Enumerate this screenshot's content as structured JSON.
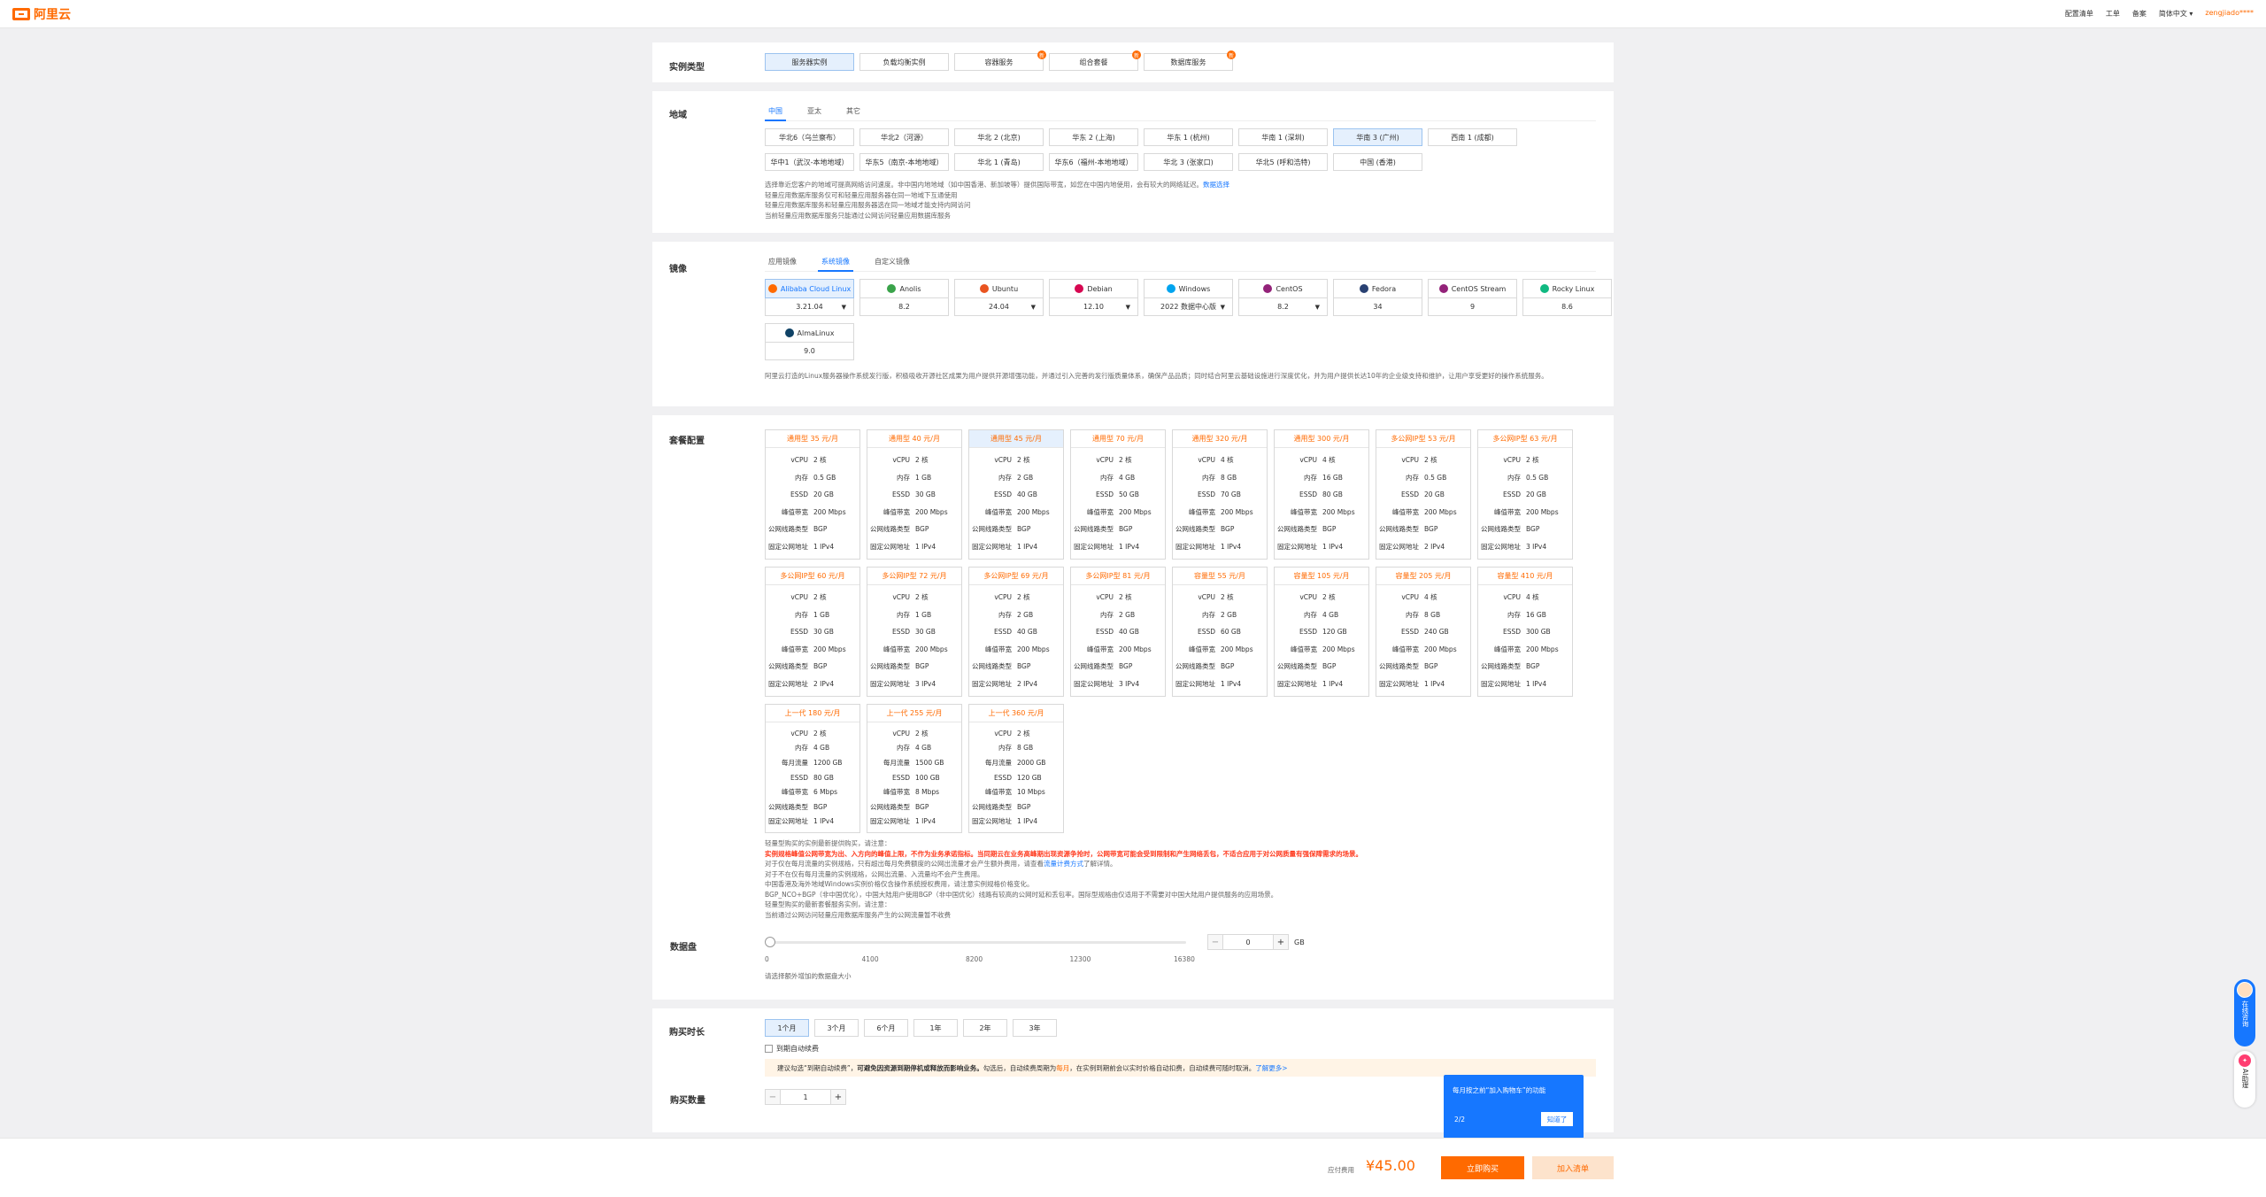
{
  "topbar": {
    "logo": "阿里云",
    "nav": [
      "配置清单",
      "工单",
      "备案",
      "简体中文"
    ],
    "user": "zengjiado****"
  },
  "instance_type": {
    "label": "实例类型",
    "options": [
      "服务器实例",
      "负载均衡实例",
      "容器服务",
      "组合套餐",
      "数据库服务"
    ],
    "selected": 0
  },
  "region": {
    "label": "地域",
    "tabs": [
      "中国",
      "亚太",
      "其它"
    ],
    "row1": [
      "华北6（乌兰察布）",
      "华北2（河源）",
      "华北 2 (北京)",
      "华东 2 (上海)",
      "华东 1 (杭州)",
      "华南 1 (深圳)",
      "华南 3 (广州)",
      "西南 1 (成都)"
    ],
    "row2": [
      "华中1（武汉-本地地域）",
      "华东5（南京-本地地域）",
      "华北 1 (青岛)",
      "华东6（福州-本地地域）",
      "华北 3 (张家口)",
      "华北5 (呼和浩特)",
      "中国 (香港)"
    ],
    "selected": "华南 3 (广州)",
    "notes": [
      "选择靠近您客户的地域可提高网络访问速度。非中国内地地域（如中国香港、新加坡等）提供国际带宽，如您在中国内地使用，会有较大的网络延迟。",
      "数据选择",
      "轻量应用数据库服务仅可和轻量应用服务器在同一地域下互通使用",
      "轻量应用数据库服务和轻量应用服务器选在同一地域才能支持内网访问",
      "当前轻量应用数据库服务只能通过公网访问轻量应用数据库服务"
    ]
  },
  "image": {
    "label": "镜像",
    "tabs": [
      "应用镜像",
      "系统镜像",
      "自定义镜像"
    ],
    "active_tab": 1,
    "items": [
      {
        "name": "Alibaba Cloud Linux",
        "version": "3.21.04",
        "dropdown": true,
        "icon": "alinux-icon",
        "color": "#ff6a00"
      },
      {
        "name": "Anolis",
        "version": "8.2",
        "dropdown": false,
        "icon": "anolis-icon",
        "color": "#3aa34a"
      },
      {
        "name": "Ubuntu",
        "version": "24.04",
        "dropdown": true,
        "icon": "ubuntu-icon",
        "color": "#e95420"
      },
      {
        "name": "Debian",
        "version": "12.10",
        "dropdown": true,
        "icon": "debian-icon",
        "color": "#d70751"
      },
      {
        "name": "Windows",
        "version": "2022 数据中心版",
        "dropdown": true,
        "icon": "windows-icon",
        "color": "#00a4ef"
      },
      {
        "name": "CentOS",
        "version": "8.2",
        "dropdown": true,
        "icon": "centos-icon",
        "color": "#932279"
      },
      {
        "name": "Fedora",
        "version": "34",
        "dropdown": false,
        "icon": "fedora-icon",
        "color": "#294172"
      },
      {
        "name": "CentOS Stream",
        "version": "9",
        "dropdown": false,
        "icon": "centos-stream-icon",
        "color": "#932279"
      },
      {
        "name": "Rocky Linux",
        "version": "8.6",
        "dropdown": false,
        "icon": "rocky-icon",
        "color": "#10b981"
      },
      {
        "name": "AlmaLinux",
        "version": "9.0",
        "dropdown": false,
        "icon": "alma-icon",
        "color": "#0f4266"
      }
    ],
    "note": "阿里云打造的Linux服务器操作系统发行版，积极吸收开源社区成果为用户提供开源增强功能，并通过引入完善的发行版质量体系，确保产品品质；同时结合阿里云基础设施进行深度优化，并为用户提供长达10年的企业级支持和维护，让用户享受更好的操作系统服务。"
  },
  "plans": {
    "label": "套餐配置",
    "keys": {
      "vcpu": "vCPU",
      "mem": "内存",
      "essd": "ESSD",
      "bw": "峰值带宽",
      "line": "公网线路类型",
      "ip": "固定公网地址",
      "traffic": "每月流量"
    },
    "items": [
      {
        "head": "通用型 35 元/月",
        "vcpu": "2 核",
        "mem": "0.5 GB",
        "essd": "20 GB",
        "bw": "200 Mbps",
        "line": "BGP",
        "ip": "1 IPv4"
      },
      {
        "head": "通用型 40 元/月",
        "vcpu": "2 核",
        "mem": "1 GB",
        "essd": "30 GB",
        "bw": "200 Mbps",
        "line": "BGP",
        "ip": "1 IPv4"
      },
      {
        "head": "通用型 45 元/月",
        "vcpu": "2 核",
        "mem": "2 GB",
        "essd": "40 GB",
        "bw": "200 Mbps",
        "line": "BGP",
        "ip": "1 IPv4",
        "selected": true
      },
      {
        "head": "通用型 70 元/月",
        "vcpu": "2 核",
        "mem": "4 GB",
        "essd": "50 GB",
        "bw": "200 Mbps",
        "line": "BGP",
        "ip": "1 IPv4"
      },
      {
        "head": "通用型 320 元/月",
        "vcpu": "4 核",
        "mem": "8 GB",
        "essd": "70 GB",
        "bw": "200 Mbps",
        "line": "BGP",
        "ip": "1 IPv4"
      },
      {
        "head": "通用型 300 元/月",
        "vcpu": "4 核",
        "mem": "16 GB",
        "essd": "80 GB",
        "bw": "200 Mbps",
        "line": "BGP",
        "ip": "1 IPv4"
      },
      {
        "head": "多公网IP型 53 元/月",
        "vcpu": "2 核",
        "mem": "0.5 GB",
        "essd": "20 GB",
        "bw": "200 Mbps",
        "line": "BGP",
        "ip": "2 IPv4"
      },
      {
        "head": "多公网IP型 63 元/月",
        "vcpu": "2 核",
        "mem": "0.5 GB",
        "essd": "20 GB",
        "bw": "200 Mbps",
        "line": "BGP",
        "ip": "3 IPv4"
      },
      {
        "head": "多公网IP型 60 元/月",
        "vcpu": "2 核",
        "mem": "1 GB",
        "essd": "30 GB",
        "bw": "200 Mbps",
        "line": "BGP",
        "ip": "2 IPv4"
      },
      {
        "head": "多公网IP型 72 元/月",
        "vcpu": "2 核",
        "mem": "1 GB",
        "essd": "30 GB",
        "bw": "200 Mbps",
        "line": "BGP",
        "ip": "3 IPv4"
      },
      {
        "head": "多公网IP型 69 元/月",
        "vcpu": "2 核",
        "mem": "2 GB",
        "essd": "40 GB",
        "bw": "200 Mbps",
        "line": "BGP",
        "ip": "2 IPv4"
      },
      {
        "head": "多公网IP型 81 元/月",
        "vcpu": "2 核",
        "mem": "2 GB",
        "essd": "40 GB",
        "bw": "200 Mbps",
        "line": "BGP",
        "ip": "3 IPv4"
      },
      {
        "head": "容量型 55 元/月",
        "vcpu": "2 核",
        "mem": "2 GB",
        "essd": "60 GB",
        "bw": "200 Mbps",
        "line": "BGP",
        "ip": "1 IPv4"
      },
      {
        "head": "容量型 105 元/月",
        "vcpu": "2 核",
        "mem": "4 GB",
        "essd": "120 GB",
        "bw": "200 Mbps",
        "line": "BGP",
        "ip": "1 IPv4"
      },
      {
        "head": "容量型 205 元/月",
        "vcpu": "4 核",
        "mem": "8 GB",
        "essd": "240 GB",
        "bw": "200 Mbps",
        "line": "BGP",
        "ip": "1 IPv4"
      },
      {
        "head": "容量型 410 元/月",
        "vcpu": "4 核",
        "mem": "16 GB",
        "essd": "300 GB",
        "bw": "200 Mbps",
        "line": "BGP",
        "ip": "1 IPv4"
      }
    ],
    "old_items": [
      {
        "head": "上一代 180 元/月",
        "vcpu": "2 核",
        "mem": "4 GB",
        "traffic": "1200 GB",
        "essd": "80 GB",
        "bw": "6 Mbps",
        "line": "BGP",
        "ip": "1 IPv4"
      },
      {
        "head": "上一代 255 元/月",
        "vcpu": "2 核",
        "mem": "4 GB",
        "traffic": "1500 GB",
        "essd": "100 GB",
        "bw": "8 Mbps",
        "line": "BGP",
        "ip": "1 IPv4"
      },
      {
        "head": "上一代 360 元/月",
        "vcpu": "2 核",
        "mem": "8 GB",
        "traffic": "2000 GB",
        "essd": "120 GB",
        "bw": "10 Mbps",
        "line": "BGP",
        "ip": "1 IPv4"
      }
    ],
    "notes": [
      "轻量型购买的实例最新提供购买，请注意：",
      "实例规格峰值公网带宽为出、入方向的峰值上限，不作为业务承诺指标。当同期云在业务高峰期出现资源争抢时，公网带宽可能会受到限制和产生网络丢包，不适合应用于对公网质量有强保障需求的场景。",
      "对于仅在每月流量的实例规格，只有超出每月免费额度的公网出流量才会产生额外费用，请查看",
      "流量计费方式",
      "了解详情。",
      "对于不在仅有每月流量的实例规格，公网出流量、入流量均不会产生费用。",
      "中国香港及海外地域Windows实例价格仅含操作系统授权费用，请注意实例规格价格变化。",
      "BGP_NCO+BGP（非中国优化），中国大陆用户使用BGP（非中国优化）线路有较高的公网时延和丢包率。国际型规格由仅适用于不需要对中国大陆用户提供服务的应用场景。",
      "轻量型购买的最新套餐服务实例，请注意：",
      "当前通过公网访问轻量应用数据库服务产生的公网流量暂不收费"
    ]
  },
  "disk": {
    "label": "数据盘",
    "ticks": [
      "0",
      "4100",
      "8200",
      "12300",
      "16380"
    ],
    "value": "0",
    "unit": "GB",
    "note": "请选择额外增加的数据盘大小"
  },
  "duration": {
    "label": "购买时长",
    "options": [
      "1个月",
      "3个月",
      "6个月",
      "1年",
      "2年",
      "3年"
    ],
    "selected": 0,
    "auto_renew": "到期自动续费",
    "tip_pre": "建议勾选“到期自动续费”，",
    "tip_bold": "可避免因资源到期停机或释放而影响业务。",
    "tip_mid": "勾选后，自动续费周期为",
    "tip_period": "每月",
    "tip_post": "，在实例到期前会以实时价格自动扣费，自动续费可随时取消。",
    "tip_link": "了解更多>"
  },
  "quantity": {
    "label": "购买数量",
    "value": "1"
  },
  "popover": {
    "title": "每月按之前“加入购物车”的功能",
    "step": "2/2",
    "button": "知道了"
  },
  "bottom": {
    "price_label": "应付费用",
    "price": "¥45.00",
    "buy": "立即购买",
    "cart": "加入清单"
  },
  "side": {
    "chat": "在线咨询",
    "ai": "AI助理"
  }
}
